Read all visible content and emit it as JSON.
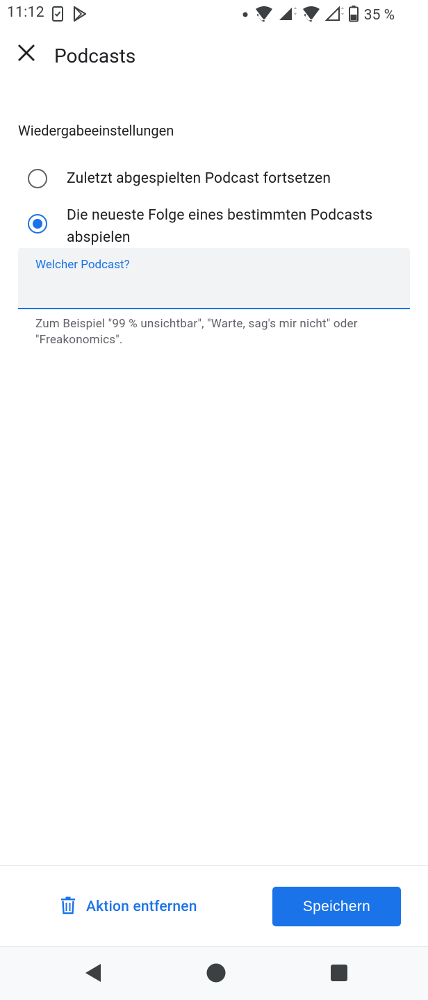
{
  "status_bar": {
    "time": "11:12",
    "battery_percent": "35 %"
  },
  "app_bar": {
    "title": "Podcasts"
  },
  "playback_settings": {
    "heading": "Wiedergabeeinstellungen",
    "options": [
      {
        "label": "Zuletzt abgespielten Podcast fortsetzen",
        "selected": false
      },
      {
        "label": "Die neueste Folge eines bestimmten Podcasts abspielen",
        "selected": true
      }
    ],
    "podcast_field": {
      "label": "Welcher Podcast?",
      "value": "",
      "helper": "Zum Beispiel \"99 % unsichtbar\", \"Warte, sag's mir nicht\" oder \"Freakonomics\"."
    }
  },
  "actions": {
    "remove_label": "Aktion entfernen",
    "save_label": "Speichern"
  },
  "colors": {
    "accent": "#1a73e8",
    "text_primary": "#202124",
    "text_secondary": "#5f6368",
    "field_background": "#f1f3f4"
  },
  "icons": {
    "close": "close-icon",
    "remove": "trash-icon",
    "nav_back": "back-triangle-icon",
    "nav_home": "home-circle-icon",
    "nav_recents": "recents-square-icon"
  }
}
